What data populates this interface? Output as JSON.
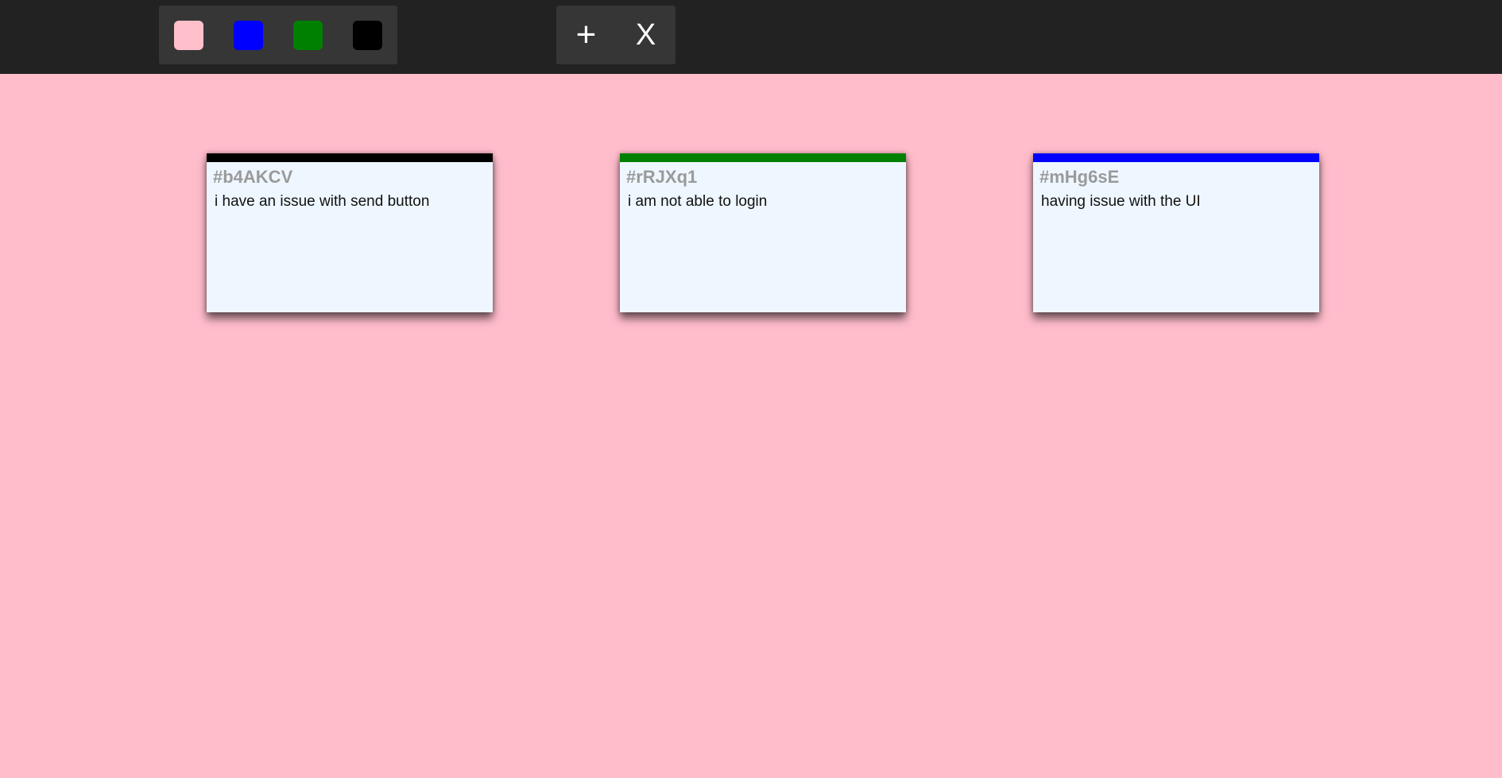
{
  "toolbar": {
    "colors": [
      {
        "name": "pink",
        "hex": "#ffc0cb"
      },
      {
        "name": "blue",
        "hex": "#0000ff"
      },
      {
        "name": "green",
        "hex": "#008000"
      },
      {
        "name": "black",
        "hex": "#000000"
      }
    ],
    "add_label": "+",
    "close_label": "X"
  },
  "tickets": [
    {
      "id": "#b4AKCV",
      "text": "i have an issue with send button",
      "color": "#000000"
    },
    {
      "id": "#rRJXq1",
      "text": "i am not able to login",
      "color": "#008000"
    },
    {
      "id": "#mHg6sE",
      "text": "having issue with the UI",
      "color": "#0000ff"
    }
  ],
  "theme": {
    "background": "#ffbccb",
    "toolbar": "#222222",
    "panel": "#363636",
    "ticket_background": "#eef7ff"
  }
}
